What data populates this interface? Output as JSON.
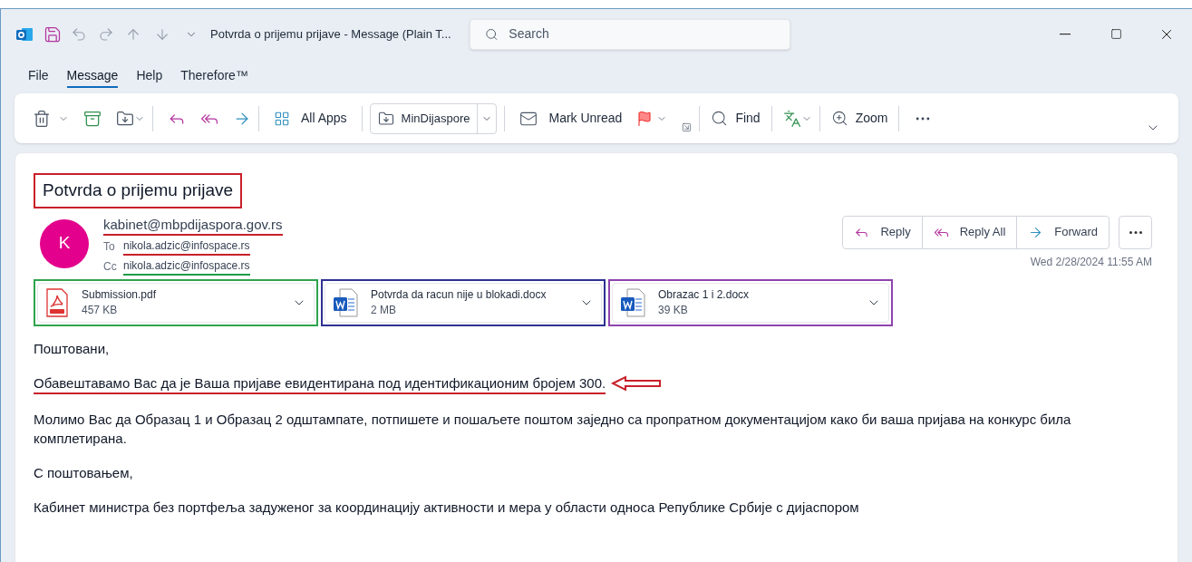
{
  "window": {
    "title": "Potvrda o prijemu prijave  -  Message (Plain T..."
  },
  "search": {
    "placeholder": "Search"
  },
  "menu_tabs": [
    {
      "label": "File",
      "selected": false
    },
    {
      "label": "Message",
      "selected": true
    },
    {
      "label": "Help",
      "selected": false
    },
    {
      "label": "Therefore™",
      "selected": false
    }
  ],
  "ribbon": {
    "apps_label": "All Apps",
    "move_target": "MinDijaspore",
    "mark_unread": "Mark Unread",
    "find": "Find",
    "zoom": "Zoom"
  },
  "message": {
    "subject": "Potvrda o prijemu prijave",
    "avatar_letter": "K",
    "sender": "kabinet@mbpdijaspora.gov.rs",
    "recipients": [
      {
        "label": "To",
        "address": "nikola.adzic@infospace.rs",
        "color": "#c8202a"
      },
      {
        "label": "Cc",
        "address": "nikola.adzic@infospace.rs",
        "color": "#1f9b46"
      }
    ],
    "actions": [
      "Reply",
      "Reply All",
      "Forward"
    ],
    "date": "Wed 2/28/2024 11:55 AM",
    "attachments": [
      {
        "kind": "pdf",
        "name": "Submission.pdf",
        "size": "457 KB",
        "color": "#2ea44f"
      },
      {
        "kind": "word",
        "name": "Potvrda da racun nije u blokadi.docx",
        "size": "2 MB",
        "color": "#2e3192"
      },
      {
        "kind": "word",
        "name": "Obrazac 1 i 2.docx",
        "size": "39 KB",
        "color": "#8e44ad"
      }
    ],
    "body": [
      {
        "kind": "plain",
        "text": "Поштовани,"
      },
      {
        "kind": "marked",
        "text": "Обавештавамо Вас да је Ваша пријаве евидентирана под идентификационим бројем 300."
      },
      {
        "kind": "plain",
        "text": "Молимо Вас да Образац 1 и Образац 2 одштампате, потпишете и пошаљете поштом заједно са пропратном документацијом како би ваша пријава на конкурс била комплетирана."
      },
      {
        "kind": "plain",
        "text": "С поштовањем,"
      },
      {
        "kind": "plain",
        "text": "Кабинет министра без портфеља задуженог за координацију активности и мера у области односа Републике Србије с дијаспором"
      }
    ]
  }
}
